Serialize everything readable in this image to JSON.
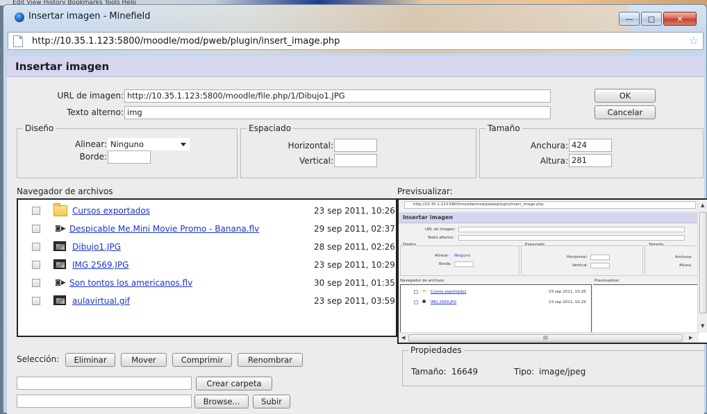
{
  "os_menu_strip": "Edit   View   History   Bookmarks   Tools   Help",
  "window": {
    "title": "Insertar imagen - Minefield",
    "minimize": "—",
    "maximize": "□",
    "close": "✕",
    "url": "http://10.35.1.123:5800/moodle/mod/pweb/plugin/insert_image.php"
  },
  "dialog": {
    "heading": "Insertar imagen",
    "url_label": "URL de imagen:",
    "url_value": "http://10.35.1.123:5800/moodle/file.php/1/Dibujo1.JPG",
    "alt_label": "Texto alterno:",
    "alt_value": "img",
    "ok": "OK",
    "cancel": "Cancelar"
  },
  "diseno": {
    "legend": "Diseño",
    "align_label": "Alinear:",
    "align_value": "Ninguno",
    "border_label": "Borde:",
    "border_value": ""
  },
  "espaciado": {
    "legend": "Espaciado",
    "horizontal_label": "Horizontal:",
    "horizontal_value": "",
    "vertical_label": "Vertical:",
    "vertical_value": ""
  },
  "tamano": {
    "legend": "Tamaño",
    "width_label": "Anchura:",
    "width_value": "424",
    "height_label": "Altura:",
    "height_value": "281"
  },
  "browser": {
    "label": "Navegador de archivos",
    "files": [
      {
        "name": "Cursos exportados",
        "date": "23 sep 2011, 10:26",
        "icon": "folder-icon"
      },
      {
        "name": "Despicable Me.Mini Movie Promo - Banana.flv",
        "date": "29 sep 2011, 02:37",
        "icon": "video-icon"
      },
      {
        "name": "Dibujo1.JPG",
        "date": "28 sep 2011, 02:26",
        "icon": "image-icon"
      },
      {
        "name": "IMG 2569.JPG",
        "date": "23 sep 2011, 10:29",
        "icon": "image-icon"
      },
      {
        "name": "Son tontos los americanos.flv",
        "date": "30 sep 2011, 01:35",
        "icon": "video-icon"
      },
      {
        "name": "aulavirtual.gif",
        "date": "23 sep 2011, 03:59",
        "icon": "image-icon"
      }
    ]
  },
  "preview": {
    "label": "Previsualizar:",
    "mini": {
      "url": "http://10.35.1.123:5800/moodle/mod/pweb/plugin/insert_image.php",
      "heading": "Insertar imagen",
      "url_label": "URL de imagen:",
      "alt_label": "Texto alterno:",
      "diseno": "Diseño",
      "alinear": "Alinear:",
      "ninguno": "Ninguno",
      "borde": "Borde:",
      "espaciado": "Espaciado",
      "horizontal": "Horizontal:",
      "vertical": "Vertical:",
      "tamano": "Tamaño",
      "anchura": "Anchura:",
      "altura": "Altura:",
      "navegador": "Navegador de archivos",
      "previsualizar": "Previsualizar:",
      "file1": "Cursos exportados",
      "date1": "23 sep 2011, 10:26",
      "file2": "IMG 2569.JPG",
      "date2": "23 sep 2011, 10:29"
    },
    "hscroll_grip": "III"
  },
  "selection": {
    "label": "Selección:",
    "delete": "Eliminar",
    "move": "Mover",
    "zip": "Comprimir",
    "rename": "Renombrar"
  },
  "folder": {
    "input_value": "",
    "create": "Crear carpeta"
  },
  "upload": {
    "input_value": "",
    "browse": "Browse...",
    "upload": "Subir"
  },
  "properties": {
    "legend": "Propiedades",
    "size_label": "Tamaño:",
    "size_value": "16649",
    "type_label": "Tipo:",
    "type_value": "image/jpeg"
  }
}
